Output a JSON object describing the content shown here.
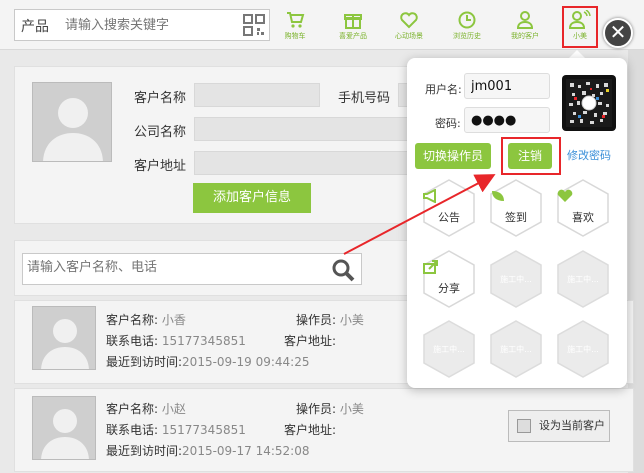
{
  "topbar": {
    "search_prefix": "产品",
    "search_placeholder": "请输入搜索关键字",
    "nav": [
      {
        "label": "购物车",
        "icon": "cart-icon"
      },
      {
        "label": "喜爱产品",
        "icon": "gift-icon"
      },
      {
        "label": "心动场景",
        "icon": "heart-icon"
      },
      {
        "label": "浏览历史",
        "icon": "clock-icon"
      },
      {
        "label": "我的客户",
        "icon": "person-icon"
      },
      {
        "label": "小美",
        "icon": "user-wifi-icon"
      }
    ]
  },
  "customer_form": {
    "name_label": "客户名称",
    "phone_label": "手机号码",
    "company_label": "公司名称",
    "address_label": "客户地址",
    "add_button": "添加客户信息"
  },
  "customer_search": {
    "placeholder": "请输入客户名称、电话"
  },
  "customers": [
    {
      "name_label": "客户名称:",
      "name": "小香",
      "operator_label": "操作员:",
      "operator": "小美",
      "phone_label": "联系电话:",
      "phone": "15177345851",
      "address_label": "客户地址:",
      "visit_label": "最近到访时间:",
      "visit": "2015-09-19 09:44:25"
    },
    {
      "name_label": "客户名称:",
      "name": "小赵",
      "operator_label": "操作员:",
      "operator": "小美",
      "phone_label": "联系电话:",
      "phone": "15177345851",
      "address_label": "客户地址:",
      "visit_label": "最近到访时间:",
      "visit": "2015-09-17 14:52:08"
    }
  ],
  "set_current_button": "设为当前客户",
  "popup": {
    "username_label": "用户名:",
    "username_value": "jm001",
    "password_label": "密码:",
    "password_value": "●●●●",
    "switch_button": "切换操作员",
    "logout_button": "注销",
    "change_password": "修改密码",
    "close_symbol": "✕",
    "tiles": [
      {
        "label": "公告",
        "icon": "megaphone-icon",
        "enabled": true
      },
      {
        "label": "签到",
        "icon": "leaf-icon",
        "enabled": true
      },
      {
        "label": "喜欢",
        "icon": "heart-icon",
        "enabled": true
      },
      {
        "label": "分享",
        "icon": "share-icon",
        "enabled": true
      },
      {
        "label": "施工中...",
        "enabled": false
      },
      {
        "label": "施工中...",
        "enabled": false
      },
      {
        "label": "施工中...",
        "enabled": false
      },
      {
        "label": "施工中...",
        "enabled": false
      },
      {
        "label": "施工中...",
        "enabled": false
      }
    ]
  },
  "colors": {
    "accent_green": "#8cc63f",
    "highlight_red": "#e8262a",
    "link_blue": "#3a8fd8"
  }
}
